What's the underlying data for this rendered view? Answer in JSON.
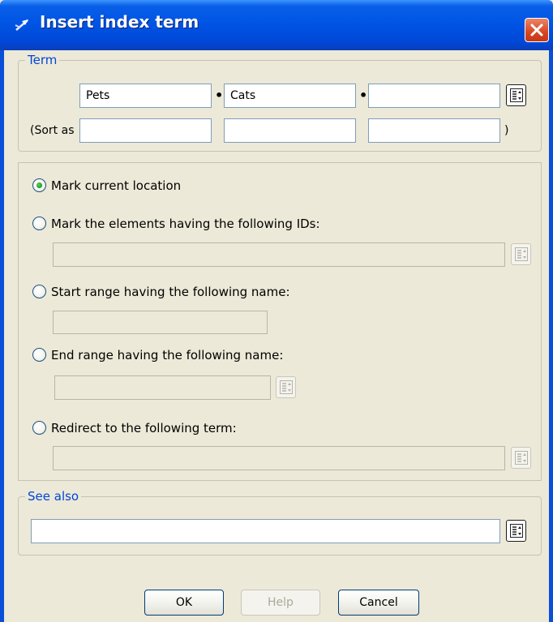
{
  "dialog": {
    "title": "Insert index term"
  },
  "term_group": {
    "legend": "Term",
    "term_fields": [
      "Pets",
      "Cats",
      ""
    ],
    "sort_as_label": "(Sort as",
    "sort_fields": [
      "",
      "",
      ""
    ],
    "close_paren": ")"
  },
  "options": {
    "selected": "mark_current",
    "mark_current_label": "Mark current location",
    "mark_ids_label": "Mark the elements having the following IDs:",
    "mark_ids_value": "",
    "start_range_label": "Start range having the following name:",
    "start_range_value": "",
    "end_range_label": "End range having the following name:",
    "end_range_value": "",
    "redirect_label": "Redirect to the following term:",
    "redirect_value": ""
  },
  "see_also_group": {
    "legend": "See also",
    "value": ""
  },
  "buttons": {
    "ok": "OK",
    "help": "Help",
    "cancel": "Cancel"
  },
  "colors": {
    "titlebar": "#0055E5",
    "dialog_bg": "#ECE9D8",
    "legend_text": "#0046D5",
    "close_button": "#D9461F"
  },
  "icons": {
    "app": "index-term-icon",
    "close": "close-icon",
    "picker": "list-picker-icon"
  }
}
